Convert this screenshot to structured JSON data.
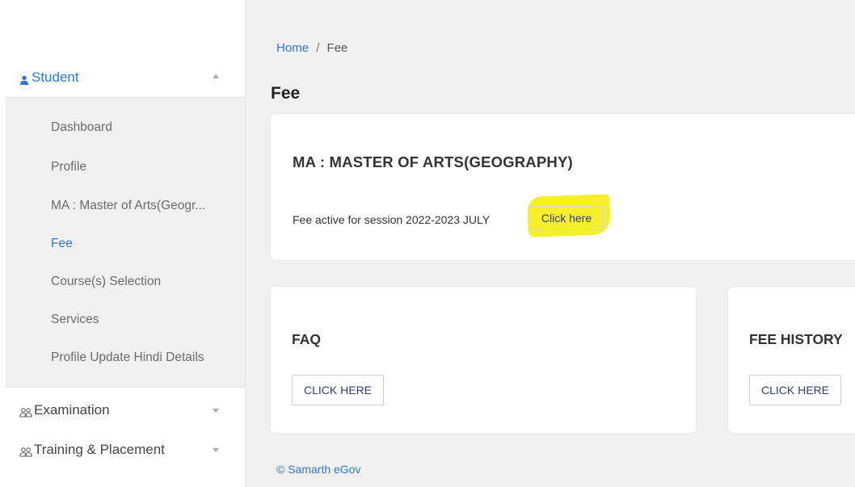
{
  "sidebar": {
    "student": {
      "label": "Student",
      "icon": "person-icon",
      "expanded": true
    },
    "items": [
      {
        "label": "Dashboard",
        "active": false
      },
      {
        "label": "Profile",
        "active": false
      },
      {
        "label": "MA : Master of Arts(Geogr...",
        "active": false
      },
      {
        "label": "Fee",
        "active": true
      },
      {
        "label": "Course(s) Selection",
        "active": false
      },
      {
        "label": "Services",
        "active": false
      },
      {
        "label": "Profile Update Hindi Details",
        "active": false
      }
    ],
    "examination": {
      "label": "Examination",
      "icon": "group-icon"
    },
    "training": {
      "label": "Training & Placement",
      "icon": "group-icon"
    }
  },
  "breadcrumb": {
    "home": "Home",
    "separator": "/",
    "current": "Fee"
  },
  "page": {
    "title": "Fee"
  },
  "program_card": {
    "title": "MA : MASTER OF ARTS(GEOGRAPHY)",
    "fee_text": "Fee active for session 2022-2023 JULY",
    "button_label": "Click here"
  },
  "faq_card": {
    "title": "FAQ",
    "button_label": "CLICK HERE"
  },
  "history_card": {
    "title": "FEE HISTORY",
    "button_label": "CLICK HERE"
  },
  "footer": {
    "text": "© Samarth eGov"
  },
  "colors": {
    "accent": "#2c77d1",
    "background": "#f0f0f0",
    "highlight": "#f7ef2a",
    "button_text": "#2f3d72"
  }
}
